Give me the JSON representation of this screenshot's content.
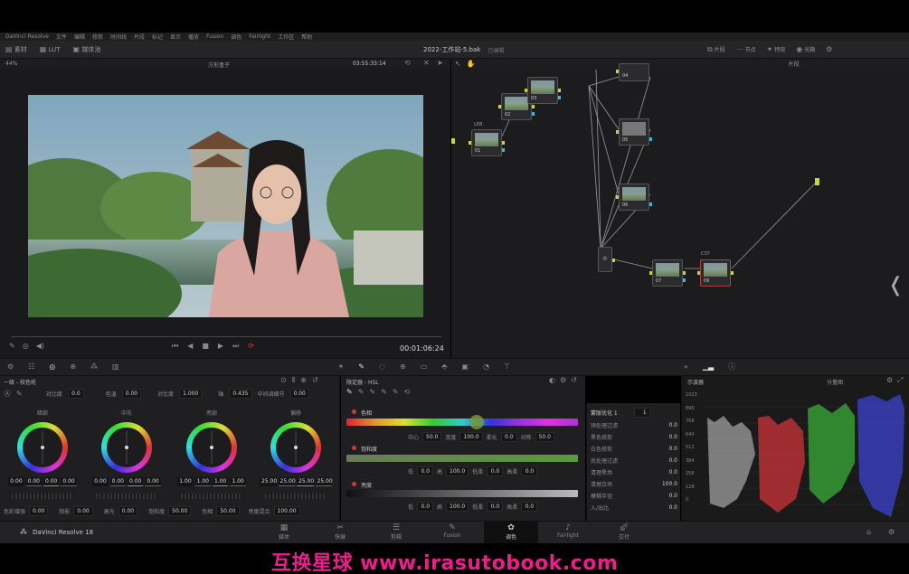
{
  "menubar": [
    "DaVinci Resolve",
    "文件",
    "编辑",
    "修剪",
    "时间线",
    "片段",
    "标记",
    "显示",
    "播放",
    "Fusion",
    "调色",
    "Fairlight",
    "工作区",
    "帮助"
  ],
  "toolbar": {
    "left_items": [
      "素材",
      "LUT",
      "媒体池"
    ],
    "project_title": "2022-工作站-5.bak",
    "project_status": "已编辑",
    "right_items": [
      "片段",
      "节点",
      "节点",
      "特效",
      "光箱"
    ]
  },
  "viewer": {
    "zoom": "44%",
    "clip_name": "方形盒子",
    "timecode": "03:55:33:14",
    "playhead_time": "00:01:06:24"
  },
  "node_editor": {
    "mode": "片段",
    "nodes": [
      {
        "label": "LEB",
        "num": "01"
      },
      {
        "label": "CST",
        "num": "02"
      },
      {
        "label": "",
        "num": "03"
      },
      {
        "label": "",
        "num": "04"
      },
      {
        "label": "",
        "num": "05"
      },
      {
        "label": "",
        "num": "06"
      },
      {
        "label": "",
        "num": "07"
      },
      {
        "label": "",
        "num": "08"
      },
      {
        "label": "CST",
        "num": "09"
      }
    ]
  },
  "wheels_panel": {
    "title": "一级 - 校色轮",
    "params": [
      {
        "label": "对比度",
        "value": "0.0"
      },
      {
        "label": "色温",
        "value": "0.00"
      },
      {
        "label": "对比度",
        "value": "1.000"
      },
      {
        "label": "轴",
        "value": "0.435"
      },
      {
        "label": "中间调细节",
        "value": "0.00"
      }
    ],
    "wheels": [
      {
        "name": "暗部",
        "values": [
          "0.00",
          "0.00",
          "0.00",
          "0.00"
        ]
      },
      {
        "name": "中灰",
        "values": [
          "0.00",
          "0.00",
          "0.00",
          "0.00"
        ]
      },
      {
        "name": "亮部",
        "values": [
          "1.00",
          "1.00",
          "1.00",
          "1.00"
        ]
      },
      {
        "name": "偏移",
        "values": [
          "25.00",
          "25.00",
          "25.00",
          "25.00"
        ]
      }
    ],
    "bottom": [
      {
        "label": "色彩增强",
        "value": "0.00"
      },
      {
        "label": "阴影",
        "value": "0.00"
      },
      {
        "label": "高光",
        "value": "0.00"
      },
      {
        "label": "饱和度",
        "value": "50.00"
      },
      {
        "label": "色相",
        "value": "50.00"
      },
      {
        "label": "亮度混合",
        "value": "100.00"
      }
    ]
  },
  "hsl_panel": {
    "title": "限定器 - HSL",
    "hue": {
      "label": "色相",
      "center": "50.0",
      "width": "100.0",
      "soft": "0.0",
      "sym": "50.0"
    },
    "sat": {
      "label": "饱和度",
      "low": "0.0",
      "high": "100.0",
      "lsoft": "0.0",
      "hsoft": "0.0"
    },
    "lum": {
      "label": "亮度",
      "low": "0.0",
      "high": "100.0",
      "lsoft": "0.0",
      "hsoft": "0.0"
    }
  },
  "keyer_panel": {
    "title": "蒙版优化 1",
    "value": "1",
    "rows": [
      {
        "label": "预处理过滤",
        "value": "0.0"
      },
      {
        "label": "黑色修剪",
        "value": "0.0"
      },
      {
        "label": "白色修剪",
        "value": "0.0"
      },
      {
        "label": "后处理过滤",
        "value": "0.0"
      },
      {
        "label": "清理黑场",
        "value": "0.0"
      },
      {
        "label": "清理白场",
        "value": "100.0"
      },
      {
        "label": "模糊半径",
        "value": "0.0"
      },
      {
        "label": "入/出比",
        "value": "0.0"
      }
    ]
  },
  "scope": {
    "title": "示波器",
    "mode": "分量图",
    "scale": [
      "1023",
      "896",
      "768",
      "640",
      "512",
      "384",
      "256",
      "128",
      "0"
    ]
  },
  "pagebar": {
    "app_name": "DaVinci Resolve 18",
    "pages": [
      "媒体",
      "快编",
      "剪辑",
      "Fusion",
      "调色",
      "Fairlight",
      "交付"
    ],
    "active": "调色"
  },
  "watermark": {
    "text": "互换星球 www.irasutobook.com"
  }
}
